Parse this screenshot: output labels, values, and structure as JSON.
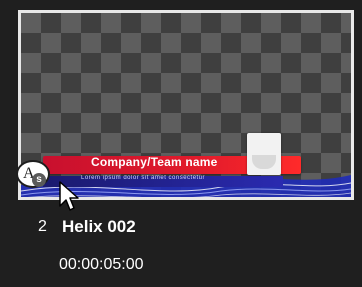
{
  "clip": {
    "index": "2",
    "name": "Helix 002",
    "duration": "00:00:05:00",
    "thumbnail": {
      "title_text": "Company/Team name",
      "subtitle_text": "Lorem ipsum dolor sit amet consectetur",
      "badge_letter": "A",
      "badge_subletter": "s",
      "badge_icon": "title-template-icon"
    }
  },
  "colors": {
    "background": "#1f1f1f",
    "thumbnail_border": "#e8e8e8",
    "lower_third_red": "#e21b2b",
    "lower_third_blue": "#1f2bb8",
    "text": "#ffffff"
  }
}
